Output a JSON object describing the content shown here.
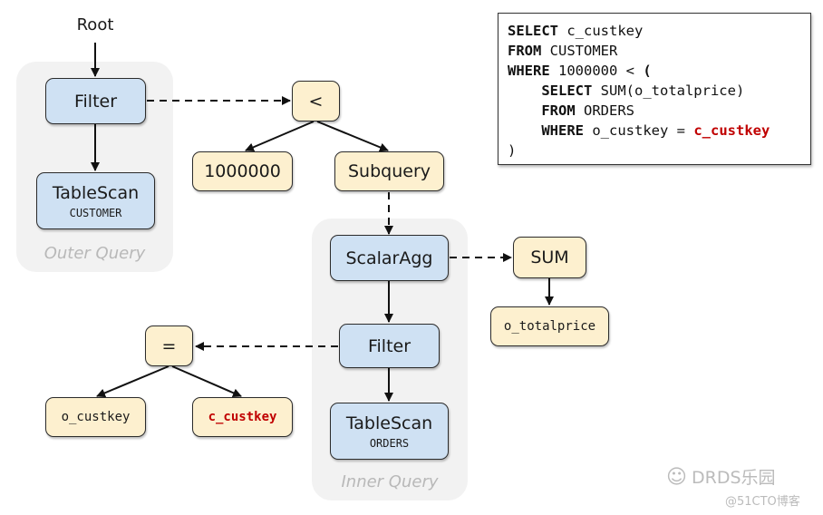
{
  "root_label": "Root",
  "groups": {
    "outer": "Outer Query",
    "inner": "Inner Query"
  },
  "nodes": {
    "outer_filter": "Filter",
    "outer_tablescan": {
      "title": "TableScan",
      "table": "CUSTOMER"
    },
    "lt": "<",
    "const": "1000000",
    "subquery": "Subquery",
    "scalaragg": "ScalarAgg",
    "sum": "SUM",
    "o_totalprice": "o_totalprice",
    "inner_filter": "Filter",
    "eq": "=",
    "o_custkey": "o_custkey",
    "c_custkey": "c_custkey",
    "inner_tablescan": {
      "title": "TableScan",
      "table": "ORDERS"
    }
  },
  "sql": {
    "lines": [
      {
        "kw": "SELECT",
        "rest": " c_custkey",
        "indent": "",
        "highlight": ""
      },
      {
        "kw": "FROM",
        "rest": " CUSTOMER",
        "indent": "",
        "highlight": ""
      },
      {
        "kw": "WHERE",
        "rest": " 1000000 < ",
        "indent": "",
        "highlight": "",
        "tail_bold": "("
      },
      {
        "kw": "SELECT",
        "rest": " SUM(o_totalprice)",
        "indent": "    ",
        "highlight": ""
      },
      {
        "kw": "FROM",
        "rest": " ORDERS",
        "indent": "    ",
        "highlight": ""
      },
      {
        "kw": "WHERE",
        "rest": " o_custkey = ",
        "indent": "    ",
        "highlight": "c_custkey"
      },
      {
        "kw": "",
        "rest": ")",
        "indent": "",
        "highlight": ""
      }
    ]
  },
  "colors": {
    "operator_fill": "#cfe1f3",
    "expression_fill": "#fdf0cf",
    "correlated_ref": "#c00000",
    "group_fill": "#f2f2f2"
  },
  "watermark": {
    "brand": "DRDS乐园",
    "source": "@51CTO博客"
  }
}
